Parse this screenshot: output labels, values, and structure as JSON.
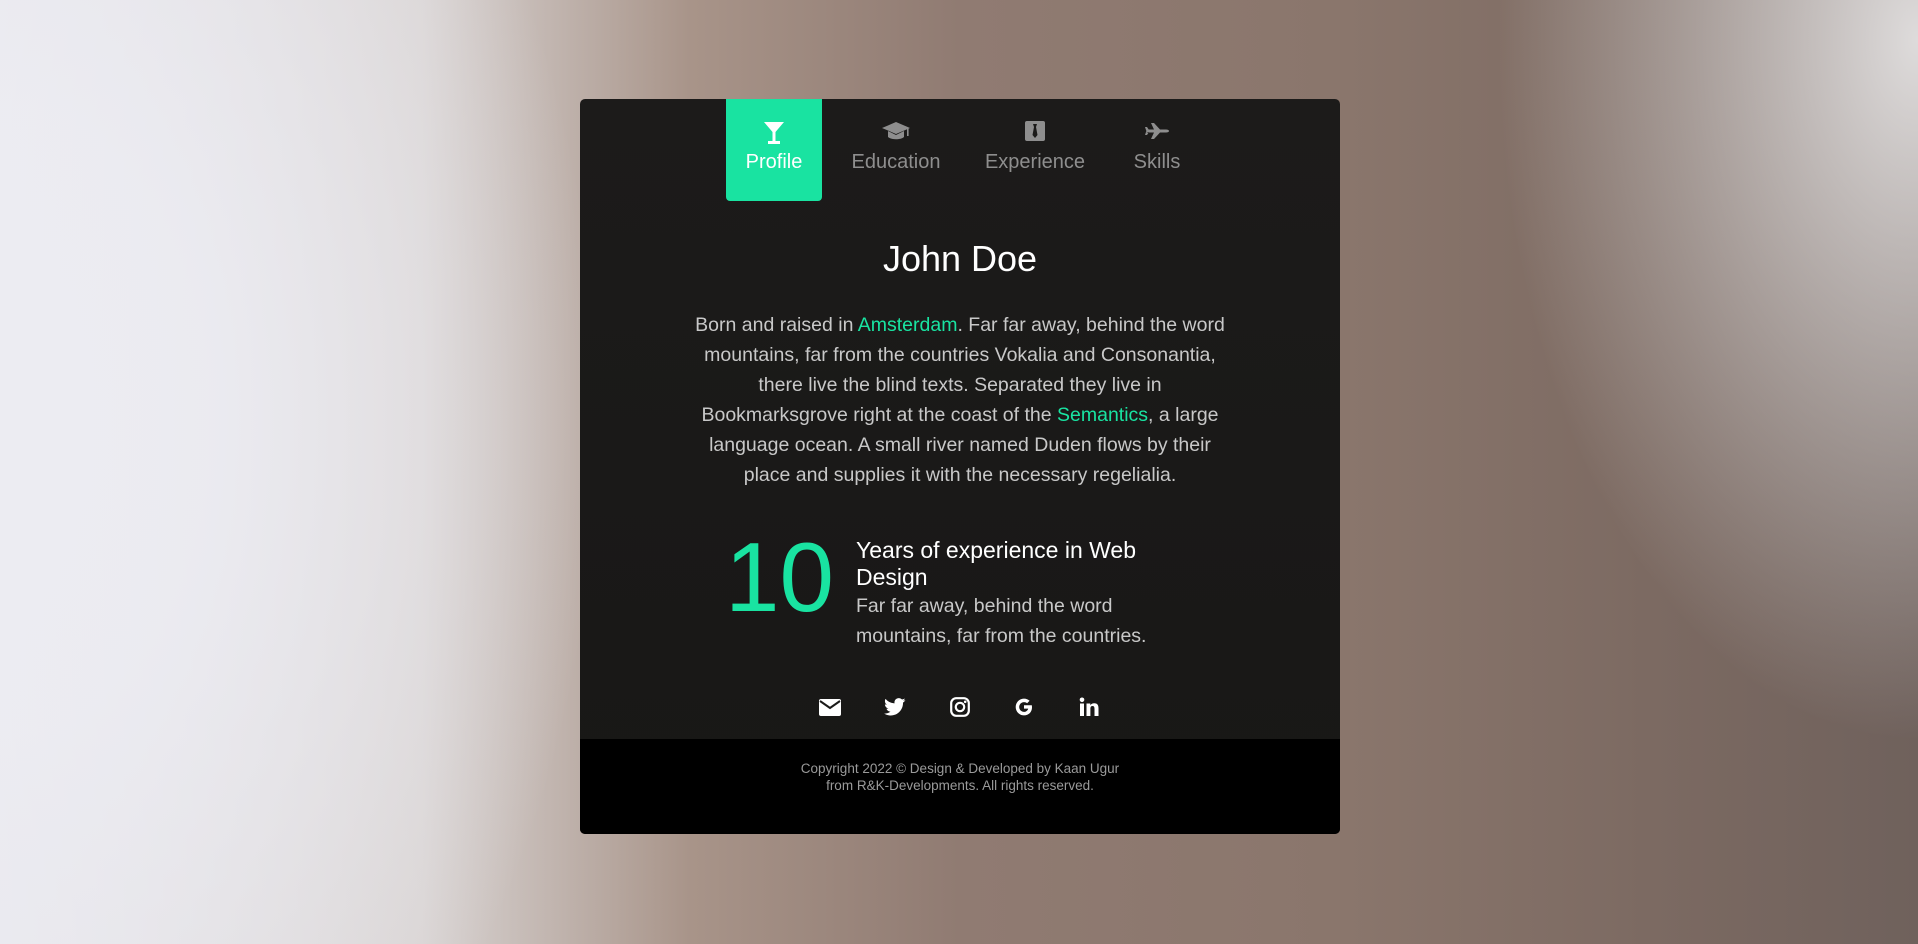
{
  "tabs": [
    {
      "label": "Profile",
      "icon": "cocktail-glass-icon",
      "active": true
    },
    {
      "label": "Education",
      "icon": "graduation-cap-icon",
      "active": false
    },
    {
      "label": "Experience",
      "icon": "suit-tie-icon",
      "active": false
    },
    {
      "label": "Skills",
      "icon": "airplane-icon",
      "active": false
    }
  ],
  "profile": {
    "name": "John Doe",
    "bio": {
      "part1": "Born and raised in ",
      "link1": "Amsterdam",
      "part2": ". Far far away, behind the word mountains, far from the countries Vokalia and Consonantia, there live the blind texts. Separated they live in Bookmarksgrove right at the coast of the ",
      "link2": "Semantics",
      "part3": ", a large language ocean. A small river named Duden flows by their place and supplies it with the necessary regelialia."
    }
  },
  "stat": {
    "number": "10",
    "title": "Years of experience in Web Design",
    "description": "Far far away, behind the word mountains, far from the countries."
  },
  "social": [
    {
      "icon": "envelope-icon"
    },
    {
      "icon": "twitter-icon"
    },
    {
      "icon": "instagram-icon"
    },
    {
      "icon": "google-icon"
    },
    {
      "icon": "linkedin-icon"
    }
  ],
  "footer": {
    "line1": "Copyright 2022 © Design & Developed by Kaan Ugur",
    "line2": "from R&K-Developments. All rights reserved."
  },
  "colors": {
    "accent": "#19e3a1",
    "card_background": "#1a1918",
    "footer_background": "#000000",
    "text_muted": "#c8c8c8",
    "tab_inactive": "#8e8e8e"
  }
}
